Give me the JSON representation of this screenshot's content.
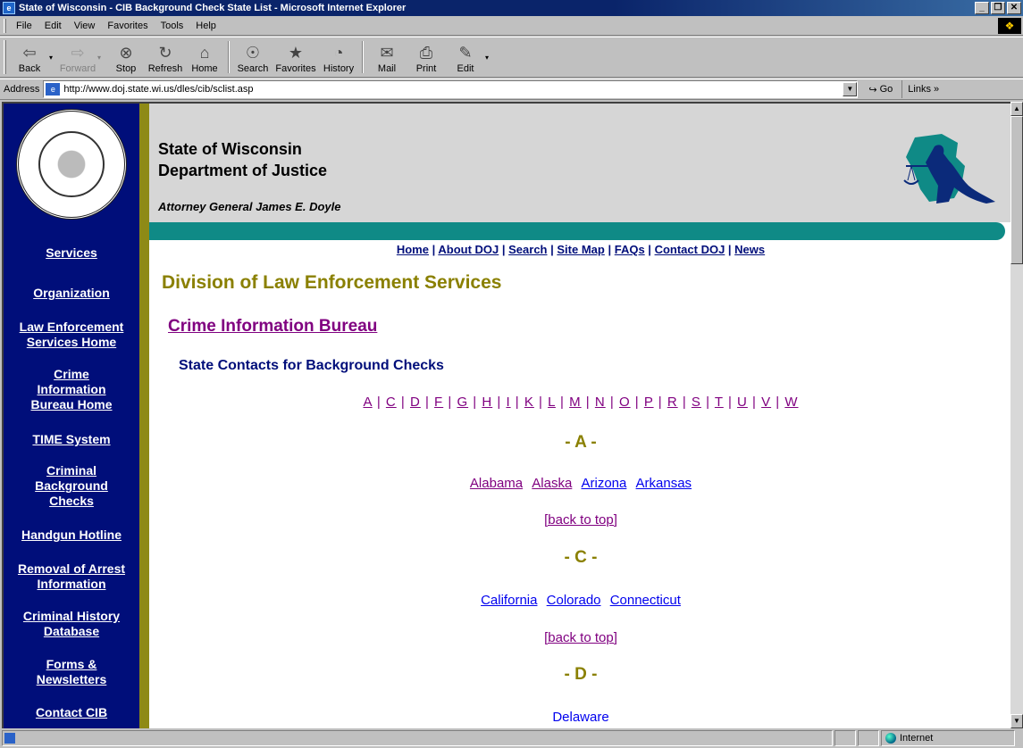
{
  "window": {
    "title": "State of Wisconsin - CIB Background Check State List - Microsoft Internet Explorer",
    "controls": [
      "_",
      "š",
      "×"
    ]
  },
  "menu": [
    "File",
    "Edit",
    "View",
    "Favorites",
    "Tools",
    "Help"
  ],
  "toolbar": {
    "back": "Back",
    "forward": "Forward",
    "stop": "Stop",
    "refresh": "Refresh",
    "home": "Home",
    "search": "Search",
    "favorites": "Favorites",
    "history": "History",
    "mail": "Mail",
    "print": "Print",
    "edit": "Edit"
  },
  "address": {
    "label": "Address",
    "url": "http://www.doj.state.wi.us/dles/cib/sclist.asp",
    "go": "Go",
    "links": "Links"
  },
  "page": {
    "org_line1": "State of Wisconsin",
    "org_line2": "Department of Justice",
    "attorney_general": "Attorney General James E. Doyle",
    "sidebar_links": [
      "Services",
      "Organization",
      "Law Enforcement Services Home",
      "Crime Information Bureau Home",
      "TIME System",
      "Criminal Background Checks",
      "Handgun Hotline",
      "Removal of Arrest Information",
      "Criminal History Database",
      "Forms & Newsletters",
      "Contact CIB"
    ],
    "top_nav": [
      "Home",
      "About DOJ",
      "Search",
      "Site Map",
      "FAQs",
      "Contact DOJ",
      "News"
    ],
    "division": "Division of Law Enforcement Services",
    "bureau": "Crime Information Bureau",
    "contacts_heading": "State Contacts for Background Checks",
    "letters": [
      "A",
      "C",
      "D",
      "F",
      "G",
      "H",
      "I",
      "K",
      "L",
      "M",
      "N",
      "O",
      "P",
      "R",
      "S",
      "T",
      "U",
      "V",
      "W"
    ],
    "sections": [
      {
        "heading": "- A -",
        "states": [
          "Alabama",
          "Alaska",
          "Arizona",
          "Arkansas"
        ]
      },
      {
        "heading": "- C -",
        "states": [
          "California",
          "Colorado",
          "Connecticut"
        ]
      },
      {
        "heading": "- D -",
        "states": [
          "Delaware"
        ]
      }
    ],
    "back_to_top": "[back to top]"
  },
  "status": {
    "zone": "Internet"
  },
  "colors": {
    "sidebar": "#000e7a",
    "accent_olive": "#8a8000",
    "teal": "#0f8a86",
    "visited": "#800080",
    "link": "#0000ee"
  }
}
